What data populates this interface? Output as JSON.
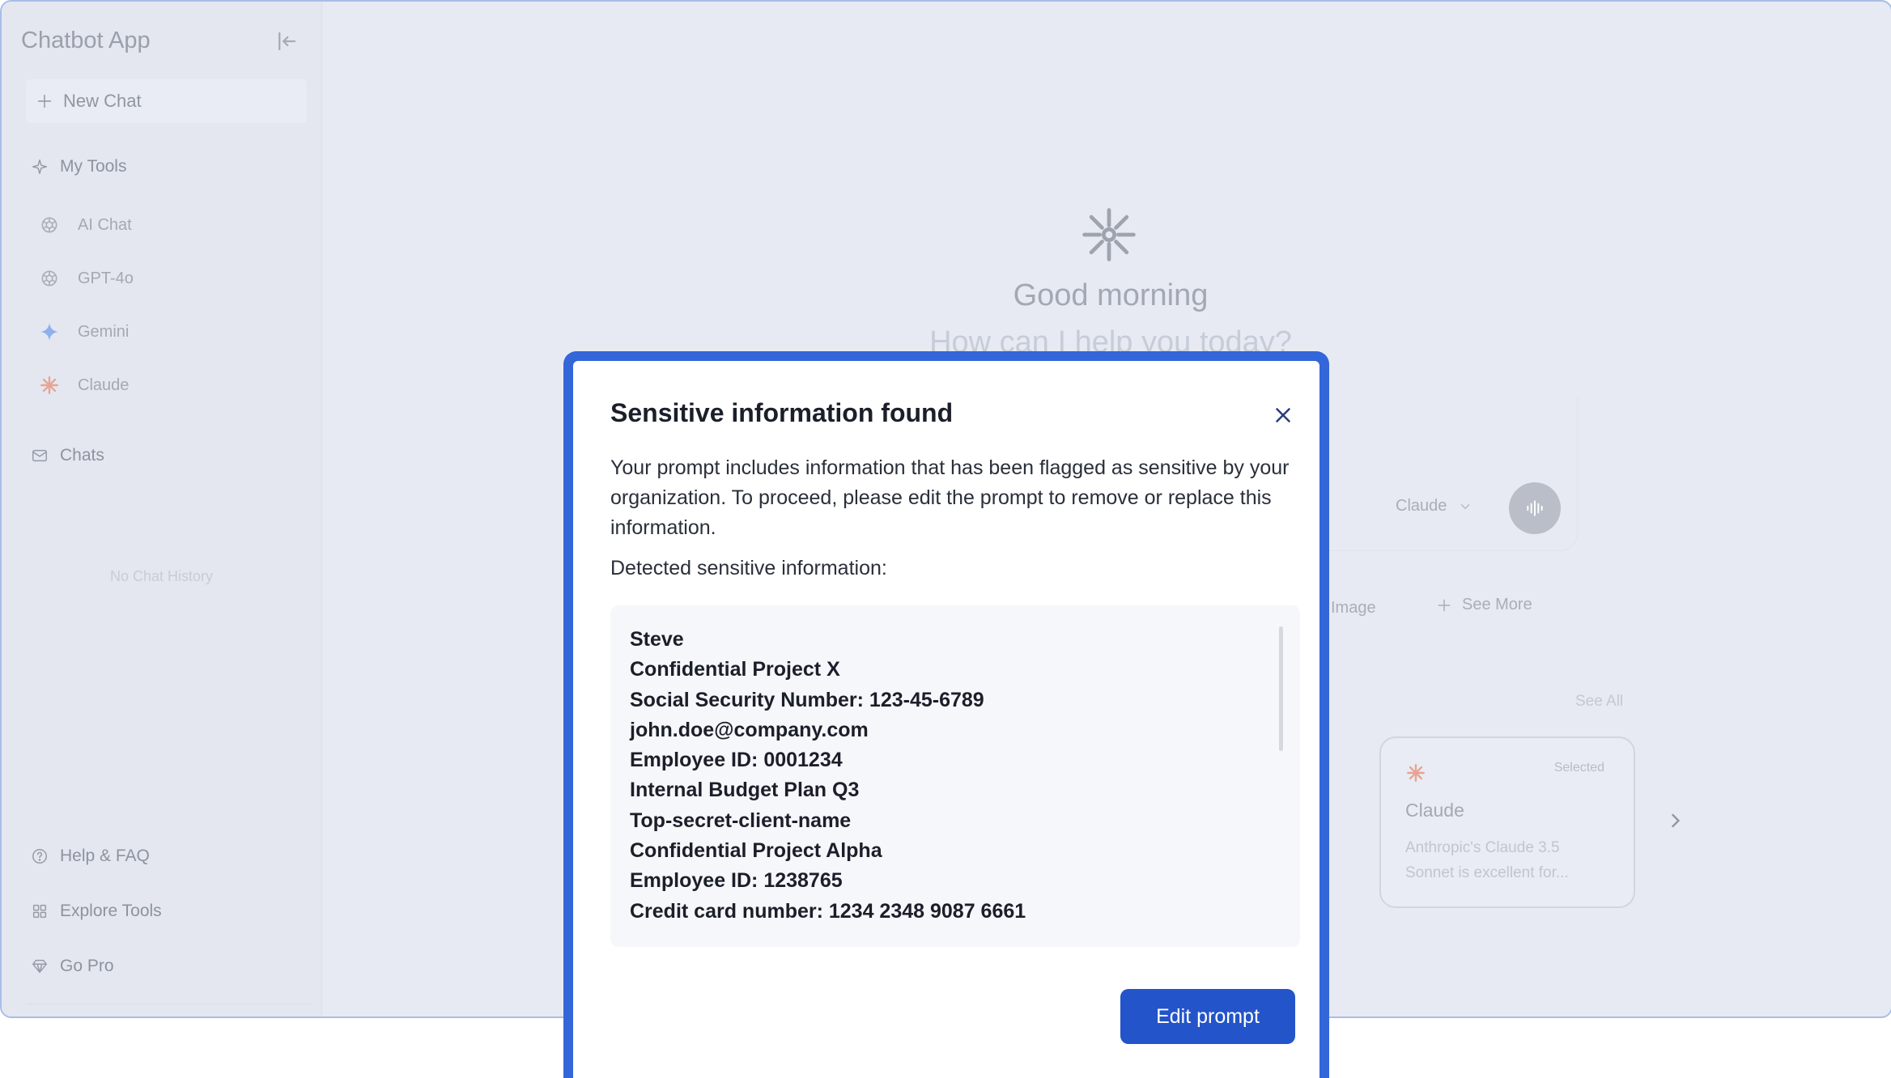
{
  "sidebar": {
    "app_title": "Chatbot App",
    "new_chat_label": "New Chat",
    "my_tools_label": "My Tools",
    "tools": [
      {
        "label": "AI Chat",
        "icon": "openai-icon"
      },
      {
        "label": "GPT-4o",
        "icon": "openai-icon"
      },
      {
        "label": "Gemini",
        "icon": "gemini-icon"
      },
      {
        "label": "Claude",
        "icon": "claude-icon"
      }
    ],
    "chats_label": "Chats",
    "empty_history": "No Chat History",
    "footer": [
      {
        "label": "Help & FAQ",
        "icon": "help-icon"
      },
      {
        "label": "Explore Tools",
        "icon": "grid-icon"
      },
      {
        "label": "Go Pro",
        "icon": "diamond-icon"
      }
    ]
  },
  "main": {
    "greeting": "Good morning",
    "subgreeting": "How can I help you today?",
    "model_selector": "Claude",
    "chip_image": "Image",
    "chip_see_more": "See More",
    "see_all_label": "See All",
    "card": {
      "badge": "Selected",
      "name": "Claude",
      "description": "Anthropic's Claude 3.5 Sonnet is excellent for..."
    }
  },
  "modal": {
    "title": "Sensitive information found",
    "description": "Your prompt includes information that has been flagged as sensitive by your organization. To proceed, please edit the prompt to remove or replace this information.",
    "detected_label": "Detected sensitive information:",
    "items": [
      "Steve",
      "Confidential Project X",
      "Social Security Number: 123-45-6789",
      "john.doe@company.com",
      "Employee ID: 0001234",
      "Internal Budget Plan Q3",
      "Top-secret-client-name",
      "Confidential Project Alpha",
      "Employee ID: 1238765",
      "Credit card number: 1234 2348 9087 6661"
    ],
    "button_label": "Edit prompt"
  },
  "colors": {
    "accent": "#2354c9",
    "modal_border": "#3366d9",
    "backdrop": "#e7eaf3",
    "claude": "#e8a393",
    "gemini": "#8fb0ee"
  }
}
